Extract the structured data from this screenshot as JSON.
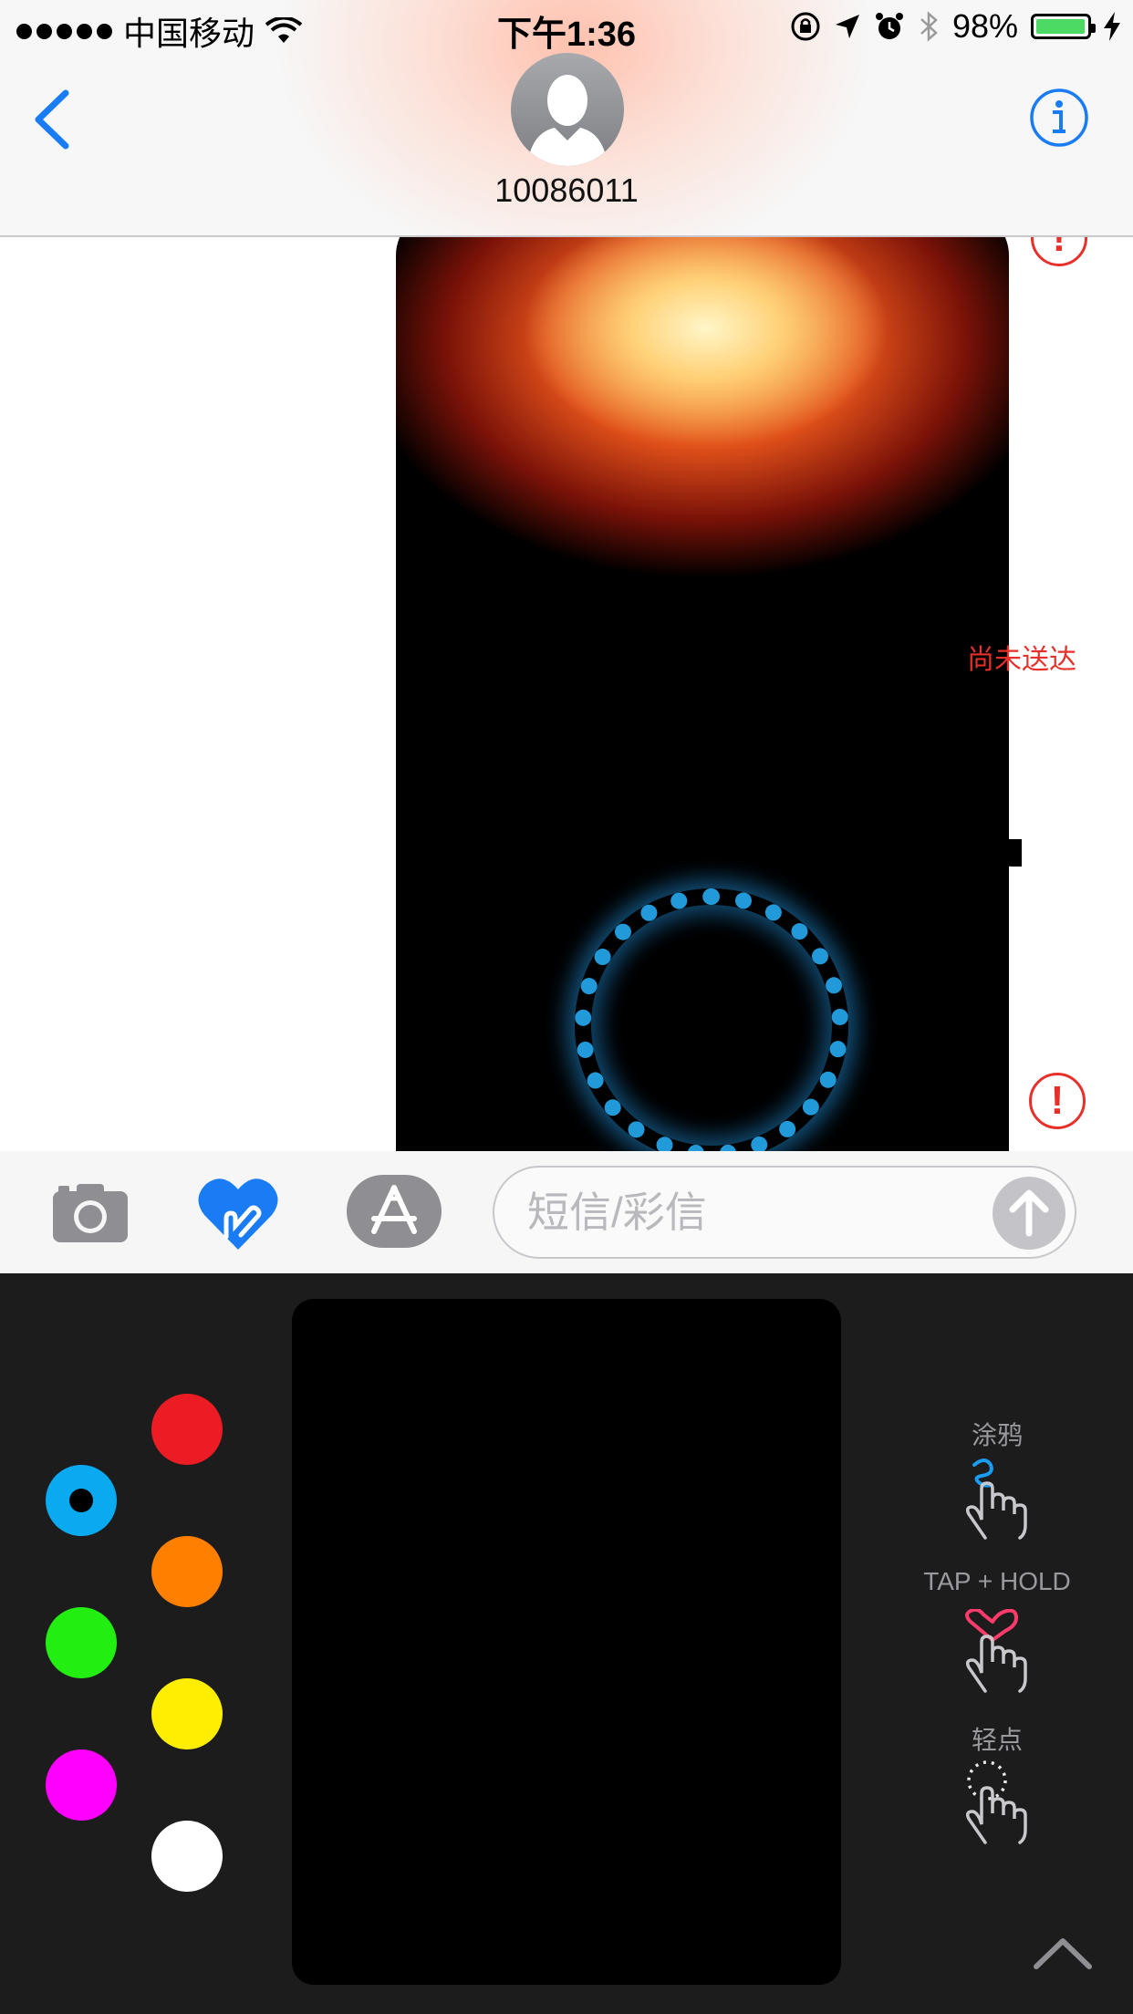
{
  "status_bar": {
    "signal_dots": 5,
    "carrier": "中国移动",
    "time": "下午1:36",
    "battery_percent_text": "98%",
    "battery_level": 0.98,
    "battery_color": "#4cd964"
  },
  "header": {
    "contact_name": "10086011",
    "back_icon": "chevron-left-icon",
    "info_icon": "info-icon",
    "accent_color": "#1a7cf5"
  },
  "messages": {
    "status_text": "尚未送达",
    "status_color": "#e8302a",
    "items": [
      {
        "kind": "digital-touch-fireball",
        "failed": true
      },
      {
        "kind": "digital-touch-ring",
        "failed": true
      }
    ]
  },
  "input_bar": {
    "placeholder": "短信/彩信",
    "camera_icon": "camera-icon",
    "digital_touch_icon": "heart-touch-icon",
    "app_store_icon": "app-store-icon",
    "send_icon": "arrow-up-icon"
  },
  "digital_touch": {
    "colors": [
      "#0aaaf0",
      "#ec1c24",
      "#ff7f00",
      "#22ee11",
      "#ffee00",
      "#ff00ff",
      "#ffffff"
    ],
    "selected_color": "#0aaaf0",
    "gestures": [
      {
        "label": "涂鸦",
        "icon": "sketch-finger-icon"
      },
      {
        "label": "TAP + HOLD",
        "icon": "heartbeat-finger-icon"
      },
      {
        "label": "轻点",
        "icon": "tap-finger-icon"
      }
    ],
    "expand_icon": "chevron-up-icon"
  }
}
